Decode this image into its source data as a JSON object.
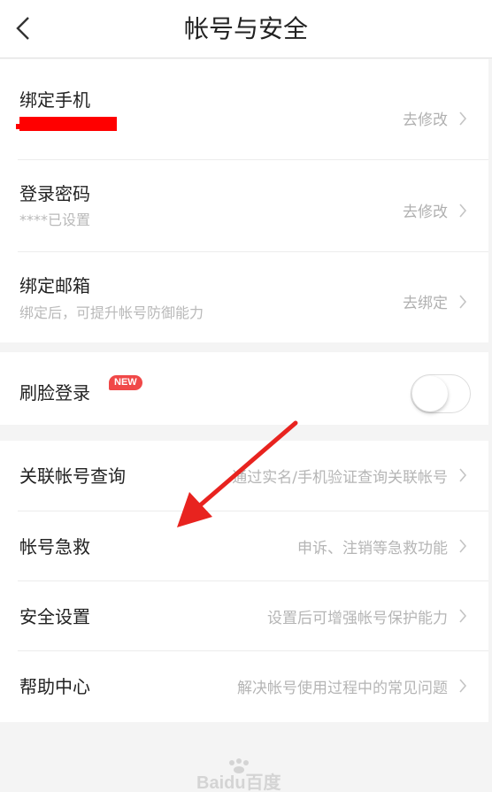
{
  "header": {
    "title": "帐号与安全",
    "back_icon": "chevron-left-icon"
  },
  "group1": {
    "items": [
      {
        "title": "绑定手机",
        "subtitle": "",
        "action": "去修改"
      },
      {
        "title": "登录密码",
        "subtitle": "****已设置",
        "action": "去修改"
      },
      {
        "title": "绑定邮箱",
        "subtitle": "绑定后，可提升帐号防御能力",
        "action": "去绑定"
      }
    ]
  },
  "face_login": {
    "title": "刷脸登录",
    "badge": "NEW",
    "enabled": false
  },
  "group3": {
    "items": [
      {
        "title": "关联帐号查询",
        "desc": "通过实名/手机验证查询关联帐号"
      },
      {
        "title": "帐号急救",
        "desc": "申诉、注销等急救功能"
      },
      {
        "title": "安全设置",
        "desc": "设置后可增强帐号保护能力"
      },
      {
        "title": "帮助中心",
        "desc": "解决帐号使用过程中的常见问题"
      }
    ]
  },
  "watermark": {
    "text": "Baidu百度"
  },
  "colors": {
    "badge": "#f04848",
    "annotation_arrow": "#e8231f",
    "redaction": "#ff0000"
  }
}
